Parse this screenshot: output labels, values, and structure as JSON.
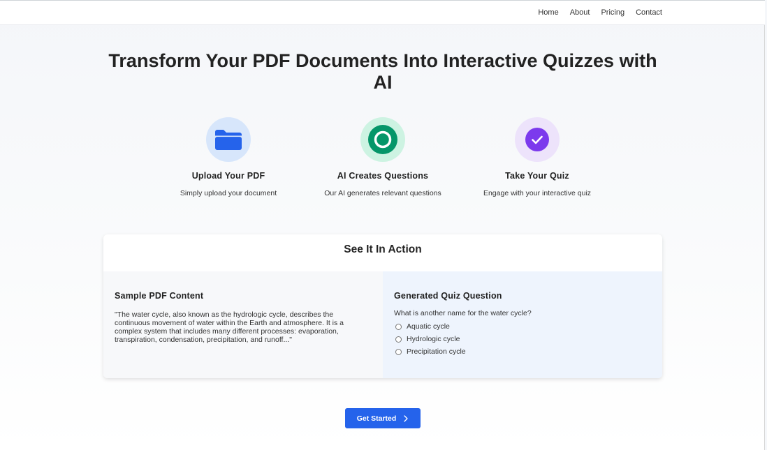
{
  "nav": {
    "items": [
      {
        "label": "Home"
      },
      {
        "label": "About"
      },
      {
        "label": "Pricing"
      },
      {
        "label": "Contact"
      }
    ]
  },
  "hero": {
    "title": "Transform Your PDF Documents Into Interactive Quizzes with AI"
  },
  "features": [
    {
      "icon": "folder-icon",
      "title": "Upload Your PDF",
      "desc": "Simply upload your document",
      "color": "#2563eb"
    },
    {
      "icon": "circle-icon",
      "title": "AI Creates Questions",
      "desc": "Our AI generates relevant questions",
      "color": "#059669"
    },
    {
      "icon": "check-icon",
      "title": "Take Your Quiz",
      "desc": "Engage with your interactive quiz",
      "color": "#7c3aed"
    }
  ],
  "demo": {
    "title": "See It In Action",
    "left": {
      "heading": "Sample PDF Content",
      "text": "\"The water cycle, also known as the hydrologic cycle, describes the continuous movement of water within the Earth and atmosphere. It is a complex system that includes many different processes: evaporation, transpiration, condensation, precipitation, and runoff...\""
    },
    "right": {
      "heading": "Generated Quiz Question",
      "question": "What is another name for the water cycle?",
      "options": [
        "Aquatic cycle",
        "Hydrologic cycle",
        "Precipitation cycle"
      ]
    }
  },
  "cta": {
    "label": "Get Started",
    "icon": "chevron-right-icon",
    "color": "#2563eb"
  }
}
